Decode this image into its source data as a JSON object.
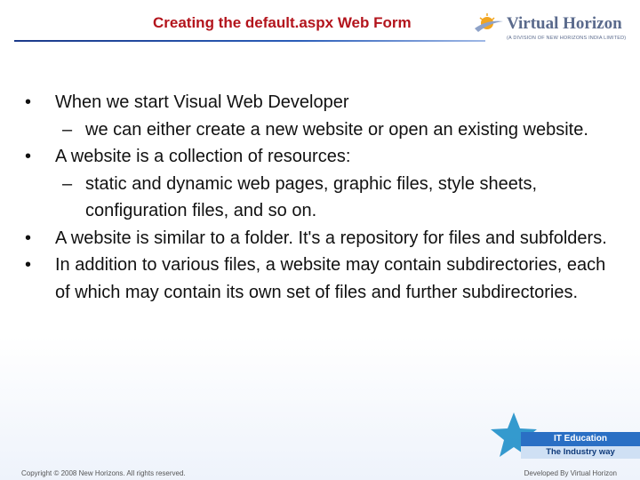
{
  "slide": {
    "title": "Creating the default.aspx Web Form",
    "logo": {
      "icon": "sun-swoosh-icon",
      "name": "Virtual Horizon",
      "subtitle": "(A DIVISION OF NEW HORIZONS INDIA LIMITED)"
    },
    "bullets": [
      {
        "text": "When we start Visual Web Developer",
        "level": 1
      },
      {
        "text": "we can either create a new website or open an existing website.",
        "level": 2
      },
      {
        "text": "A website is a collection of resources:",
        "level": 1
      },
      {
        "text": "static and dynamic web pages, graphic files, style sheets, configuration files, and so on.",
        "level": 2
      },
      {
        "text": "A website is similar to a folder. It's a repository for files and subfolders.",
        "level": 1
      },
      {
        "text": "In addition to various files, a website may contain subdirectories, each of which may contain its own set of files and further subdirectories.",
        "level": 1
      }
    ],
    "badge": {
      "icon": "star-icon",
      "line1": "IT Education",
      "line2": "The Industry way"
    },
    "footer_left": "Copyright © 2008 New Horizons. All rights reserved.",
    "footer_right": "Developed By Virtual Horizon",
    "colors": {
      "title": "#b3141c",
      "rule": "#1b3a8a",
      "badge": "#2a6fc4",
      "star": "#1f8fc9"
    }
  }
}
